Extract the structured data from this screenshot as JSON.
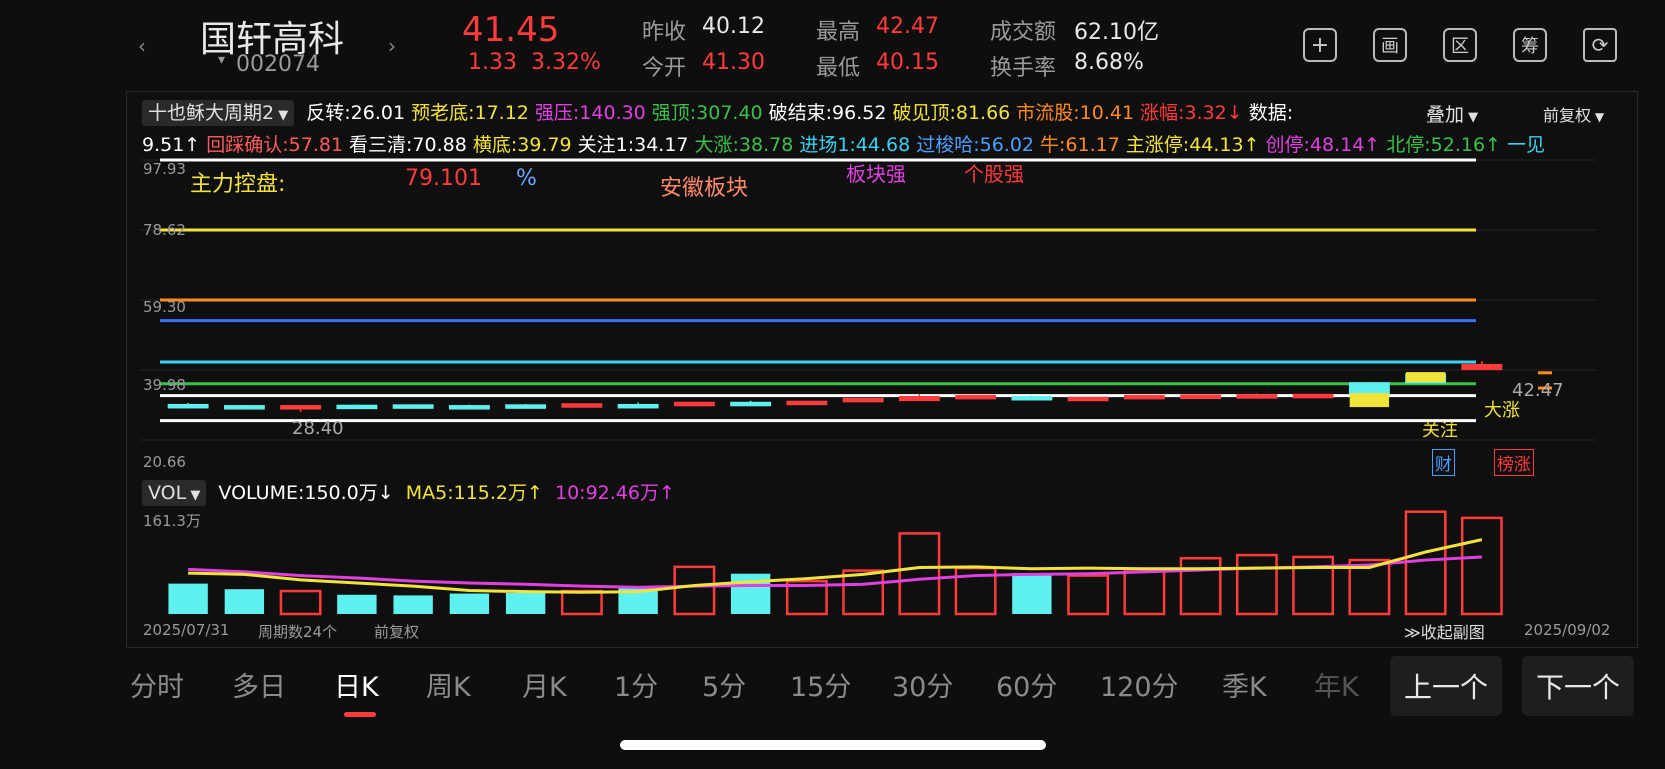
{
  "header": {
    "name": "国轩高科",
    "code": "002074",
    "price": "41.45",
    "change": "1.33",
    "change_pct": "3.32%",
    "prev_close_label": "昨收",
    "prev_close": "40.12",
    "open_label": "今开",
    "open": "41.30",
    "high_label": "最高",
    "high": "42.47",
    "low_label": "最低",
    "low": "40.15",
    "turnover_label": "成交额",
    "turnover": "62.10亿",
    "rate_label": "换手率",
    "rate": "8.68%"
  },
  "toolbar_icons": [
    "plus-icon",
    "draw-icon",
    "area-icon",
    "chip-icon",
    "rotate-icon"
  ],
  "toolbar_glyphs": [
    "+",
    "画",
    "区",
    "筹",
    "⟳"
  ],
  "indicator": {
    "name": "十也稣大周期2",
    "row1": [
      {
        "t": "反转:26.01",
        "c": "#ffffff"
      },
      {
        "t": "预老底:17.12",
        "c": "#f2e33b"
      },
      {
        "t": "强压:140.30",
        "c": "#e040e0"
      },
      {
        "t": "强顶:307.40",
        "c": "#3ac14a"
      },
      {
        "t": "破结束:96.52",
        "c": "#ffffff"
      },
      {
        "t": "破见顶:81.66",
        "c": "#f2e33b"
      },
      {
        "t": "市流股:10.41",
        "c": "#ff8a1f"
      },
      {
        "t": "涨幅:3.32↓",
        "c": "#ff3b3b"
      },
      {
        "t": "数据:",
        "c": "#ffffff"
      }
    ],
    "overlay": "叠加",
    "adjust": "前复权",
    "row2": [
      {
        "t": "9.51↑",
        "c": "#ffffff"
      },
      {
        "t": "回踩确认:57.81",
        "c": "#ff5a5a"
      },
      {
        "t": "看三清:70.88",
        "c": "#ffffff"
      },
      {
        "t": "横底:39.79",
        "c": "#f2e33b"
      },
      {
        "t": "关注1:34.17",
        "c": "#ffffff"
      },
      {
        "t": "大涨:38.78",
        "c": "#3ac14a"
      },
      {
        "t": "进场1:44.68",
        "c": "#3ad0f0"
      },
      {
        "t": "过梭哈:56.02",
        "c": "#4aa0ff"
      },
      {
        "t": "牛:61.17",
        "c": "#ff8a1f"
      },
      {
        "t": "主涨停:44.13↑",
        "c": "#f2e33b"
      },
      {
        "t": "创停:48.14↑",
        "c": "#e040e0"
      },
      {
        "t": "北停:52.16↑",
        "c": "#3ac14a"
      },
      {
        "t": "一见",
        "c": "#3ad0f0"
      }
    ]
  },
  "chart_labels": {
    "y_ticks": [
      "97.93",
      "78.62",
      "59.30",
      "39.98",
      "20.66"
    ],
    "main_force": "主力控盘:",
    "main_val": "79.101",
    "pct": "%",
    "sector": "安徽板块",
    "sector_strong": "板块强",
    "stock_strong": "个股强",
    "min_price": "28.40",
    "max_price": "42.47",
    "tag_follow": "关注",
    "tag_rise": "大涨",
    "tag_cai": "财",
    "tag_bang": "榜涨"
  },
  "volume": {
    "name": "VOL",
    "title": "VOLUME:150.0万↓",
    "ma5": "MA5:115.2万↑",
    "ma10": "10:92.46万↑",
    "max": "161.3万"
  },
  "footer": {
    "start_date": "2025/07/31",
    "periods": "周期数24个",
    "adjust": "前复权",
    "collapse": "≫收起副图",
    "end_date": "2025/09/02"
  },
  "tabs": [
    "分时",
    "多日",
    "日K",
    "周K",
    "月K",
    "1分",
    "5分",
    "15分",
    "30分",
    "60分",
    "120分",
    "季K",
    "年K"
  ],
  "active_tab": "日K",
  "nav": {
    "prev": "上一个",
    "next": "下一个"
  },
  "chart_data": {
    "type": "bar",
    "title": "",
    "xlabel": "",
    "ylabel": "",
    "x_range": [
      "2025/07/31",
      "2025/09/02"
    ],
    "price_ylim": [
      20.66,
      97.93
    ],
    "price_ticks": [
      97.93,
      78.62,
      59.3,
      39.98,
      20.66
    ],
    "candles": [
      {
        "open": 30.2,
        "close": 30.4,
        "high": 30.9,
        "low": 29.9,
        "up": false
      },
      {
        "open": 30.1,
        "close": 29.9,
        "high": 30.3,
        "low": 29.7,
        "up": false
      },
      {
        "open": 29.4,
        "close": 30.1,
        "high": 30.2,
        "low": 28.4,
        "up": true
      },
      {
        "open": 30.2,
        "close": 30.1,
        "high": 30.4,
        "low": 29.9,
        "up": false
      },
      {
        "open": 30.3,
        "close": 30.2,
        "high": 30.5,
        "low": 30.0,
        "up": false
      },
      {
        "open": 30.1,
        "close": 30.0,
        "high": 30.4,
        "low": 29.9,
        "up": false
      },
      {
        "open": 30.3,
        "close": 30.1,
        "high": 30.6,
        "low": 29.9,
        "up": false
      },
      {
        "open": 30.0,
        "close": 30.6,
        "high": 30.7,
        "low": 29.9,
        "up": true
      },
      {
        "open": 30.4,
        "close": 30.3,
        "high": 31.0,
        "low": 29.9,
        "up": false
      },
      {
        "open": 30.3,
        "close": 31.0,
        "high": 31.1,
        "low": 30.2,
        "up": true
      },
      {
        "open": 31.0,
        "close": 30.8,
        "high": 31.5,
        "low": 30.6,
        "up": false
      },
      {
        "open": 30.6,
        "close": 31.3,
        "high": 31.4,
        "low": 30.5,
        "up": true
      },
      {
        "open": 31.4,
        "close": 32.1,
        "high": 32.2,
        "low": 31.3,
        "up": true
      },
      {
        "open": 31.6,
        "close": 32.6,
        "high": 33.4,
        "low": 31.5,
        "up": true
      },
      {
        "open": 32.3,
        "close": 32.9,
        "high": 33.0,
        "low": 32.2,
        "up": true
      },
      {
        "open": 32.6,
        "close": 32.3,
        "high": 33.0,
        "low": 32.0,
        "up": false
      },
      {
        "open": 31.9,
        "close": 32.4,
        "high": 32.5,
        "low": 31.8,
        "up": true
      },
      {
        "open": 32.3,
        "close": 32.9,
        "high": 33.0,
        "low": 32.2,
        "up": true
      },
      {
        "open": 32.5,
        "close": 33.0,
        "high": 33.2,
        "low": 32.4,
        "up": true
      },
      {
        "open": 32.7,
        "close": 33.1,
        "high": 33.5,
        "low": 32.6,
        "up": true
      },
      {
        "open": 32.6,
        "close": 33.2,
        "high": 33.3,
        "low": 32.5,
        "up": true
      },
      {
        "open": 33.1,
        "close": 36.4,
        "high": 36.6,
        "low": 33.0,
        "up": false
      },
      {
        "open": 36.5,
        "close": 38.8,
        "high": 38.9,
        "low": 36.4,
        "up": false
      },
      {
        "open": 40.15,
        "close": 41.45,
        "high": 42.47,
        "low": 40.15,
        "up": true
      }
    ],
    "hlines": [
      {
        "value": 97.93,
        "color": "#ffffff"
      },
      {
        "value": 78.62,
        "color": "#f2e33b"
      },
      {
        "value": 59.3,
        "color": "#ff8a1f"
      },
      {
        "value": 53.6,
        "color": "#3a6fff"
      },
      {
        "value": 42.2,
        "color": "#3ad0f0"
      },
      {
        "value": 36.2,
        "color": "#3ac14a"
      },
      {
        "value": 32.9,
        "color": "#ffffff"
      },
      {
        "value": 26.0,
        "color": "#ffffff"
      }
    ],
    "volume": {
      "ylim": [
        0,
        161.3
      ],
      "values": [
        49,
        40,
        37,
        31,
        30,
        33,
        34,
        37,
        42,
        76,
        65,
        53,
        70,
        130,
        74,
        66,
        62,
        72,
        90,
        95,
        92,
        87,
        165,
        155
      ],
      "up": [
        false,
        false,
        true,
        false,
        false,
        false,
        false,
        true,
        false,
        true,
        false,
        true,
        true,
        true,
        true,
        false,
        true,
        true,
        true,
        true,
        true,
        true,
        true,
        true
      ],
      "ma5": [
        66,
        64,
        55,
        50,
        45,
        38,
        36,
        35,
        36,
        46,
        52,
        57,
        64,
        75,
        76,
        73,
        74,
        73,
        73,
        74,
        75,
        75,
        100,
        120
      ],
      "ma10": [
        72,
        68,
        62,
        58,
        53,
        50,
        48,
        45,
        43,
        45,
        46,
        46,
        48,
        56,
        62,
        64,
        65,
        68,
        71,
        74,
        76,
        79,
        87,
        92
      ]
    }
  }
}
